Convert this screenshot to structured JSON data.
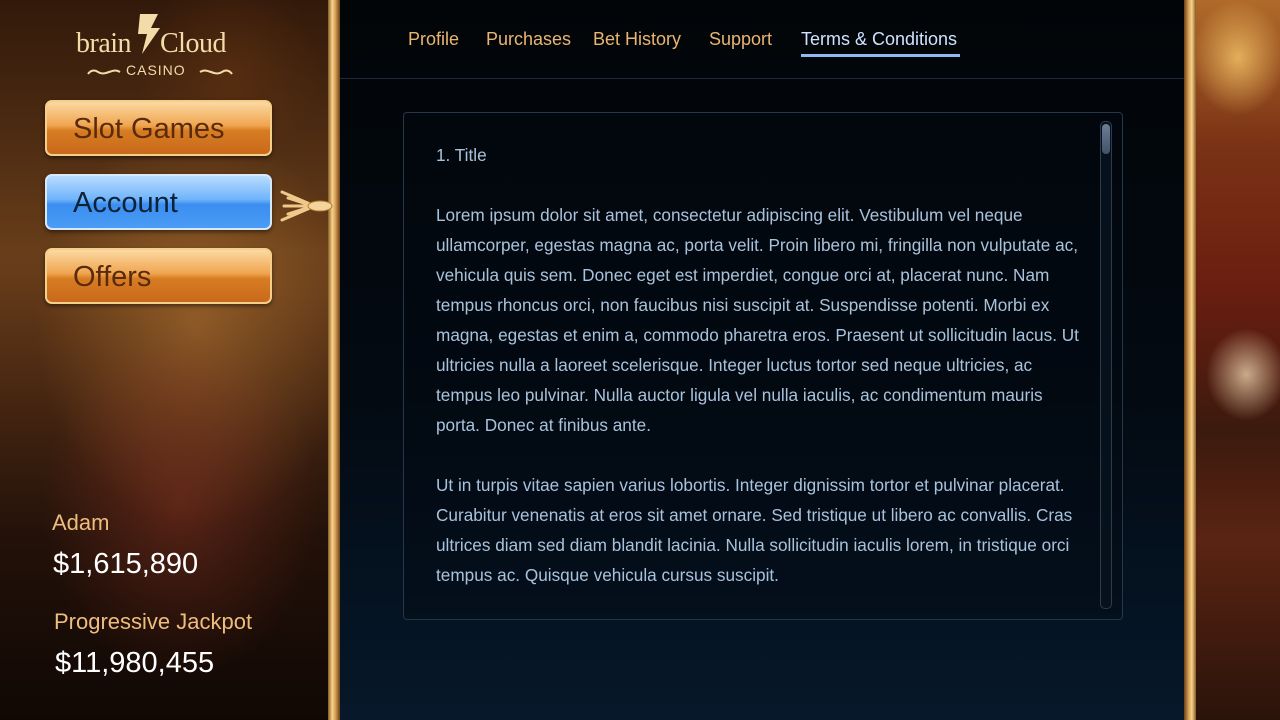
{
  "brand": {
    "word1": "brain",
    "word2": "Cloud",
    "sub": "CASINO"
  },
  "sidebar": {
    "items": [
      {
        "label": "Slot Games",
        "state": "normal"
      },
      {
        "label": "Account",
        "state": "selected"
      },
      {
        "label": "Offers",
        "state": "normal"
      }
    ]
  },
  "player": {
    "name": "Adam",
    "balance": "$1,615,890"
  },
  "jackpot": {
    "label": "Progressive Jackpot",
    "value": "$11,980,455"
  },
  "tabs": [
    {
      "label": "Profile"
    },
    {
      "label": "Purchases"
    },
    {
      "label": "Bet History"
    },
    {
      "label": "Support"
    },
    {
      "label": "Terms & Conditions",
      "active": true
    }
  ],
  "terms": {
    "heading": "1. Title",
    "paragraphs": [
      "Lorem ipsum dolor sit amet, consectetur adipiscing elit. Vestibulum vel neque ullamcorper, egestas magna ac, porta velit. Proin libero mi, fringilla non vulputate ac, vehicula quis sem. Donec eget est imperdiet, congue orci at, placerat nunc. Nam tempus rhoncus orci, non faucibus nisi suscipit at. Suspendisse potenti. Morbi ex magna, egestas et enim a, commodo pharetra eros. Praesent ut sollicitudin lacus. Ut ultricies nulla a laoreet scelerisque. Integer luctus tortor sed neque ultricies, ac tempus leo pulvinar. Nulla auctor ligula vel nulla iaculis, ac condimentum mauris porta. Donec at finibus ante.",
      "Ut in turpis vitae sapien varius lobortis. Integer dignissim tortor et pulvinar placerat. Curabitur venenatis at eros sit amet ornare. Sed tristique ut libero ac convallis. Cras ultrices diam sed diam blandit lacinia. Nulla sollicitudin iaculis lorem, in tristique orci tempus ac. Quisque vehicula cursus suscipit."
    ]
  },
  "colors": {
    "accent_orange": "#eab573",
    "active_tab": "#cfe3ff",
    "tab_underline": "#8fb9f2",
    "body_text": "#a9c2dc"
  },
  "icons": {
    "brand_mark": "lightning-bolt-icon",
    "selection_pointer": "arrow-pointer-icon"
  }
}
